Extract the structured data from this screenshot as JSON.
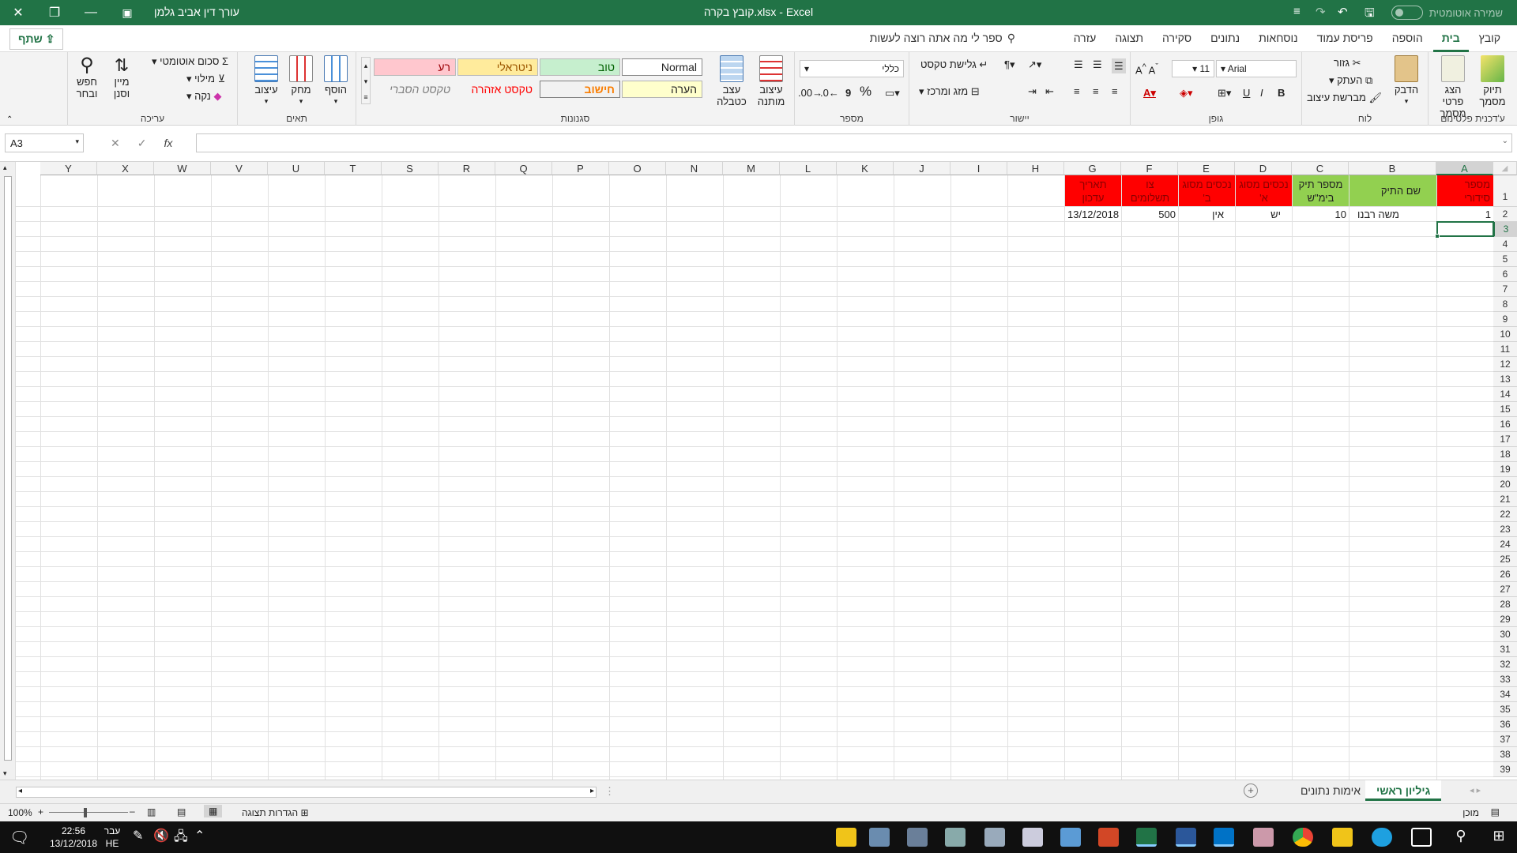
{
  "window": {
    "title": "קובץ בקרה.xlsx  -  Excel",
    "user": "עורך דין אביב גלמן",
    "autosave_label": "שמירה אוטומטית"
  },
  "tabs": [
    "קובץ",
    "בית",
    "הוספה",
    "פריסת עמוד",
    "נוסחאות",
    "נתונים",
    "סקירה",
    "תצוגה",
    "עזרה"
  ],
  "tellme": "ספר לי מה אתה רוצה לעשות",
  "share": "שתף",
  "ribbon": {
    "addins": {
      "label": "ע'דכנית פלטינום",
      "btn1": "תיוק מסמך",
      "btn2": "הצג פרטי מסמך"
    },
    "clipboard": {
      "label": "לוח",
      "paste": "הדבק",
      "cut": "גזור",
      "copy": "העתק",
      "painter": "מברשת עיצוב"
    },
    "font": {
      "label": "גופן",
      "name": "Arial",
      "size": "11",
      "bold": "B",
      "italic": "I",
      "underline": "U"
    },
    "alignment": {
      "label": "יישור",
      "wrap": "גלישת טקסט",
      "merge": "מזג ומרכז"
    },
    "number": {
      "label": "מספר",
      "format": "כללי",
      "percent": "%",
      "comma": "9"
    },
    "styles": {
      "label": "סגנונות",
      "cond": "עיצוב מותנה",
      "table": "עצב כטבלה",
      "normal": "Normal",
      "good": "טוב",
      "neutral": "ניטראלי",
      "bad": "רע",
      "note": "הערה",
      "check": "חישוב",
      "warning": "טקסט אזהרה",
      "explanatory": "טקסט הסברי"
    },
    "cells": {
      "label": "תאים",
      "insert": "הוסף",
      "delete": "מחק",
      "format": "עיצוב"
    },
    "editing": {
      "label": "עריכה",
      "autosum": "סכום אוטומטי",
      "fill": "מילוי",
      "clear": "נקה",
      "sort": "מיין וסנן",
      "find": "חפש ובחר"
    }
  },
  "namebox": "A3",
  "columns": [
    "A",
    "B",
    "C",
    "D",
    "E",
    "F",
    "G",
    "H",
    "I",
    "J",
    "K",
    "L",
    "M",
    "N",
    "O",
    "P",
    "Q",
    "R",
    "S",
    "T",
    "U",
    "V",
    "W",
    "X",
    "Y"
  ],
  "rows": [
    "1",
    "2",
    "3",
    "4",
    "5",
    "6",
    "7",
    "8",
    "9",
    "10",
    "11",
    "12",
    "13",
    "14",
    "15",
    "16",
    "17",
    "18",
    "19",
    "20",
    "21",
    "22",
    "23",
    "24",
    "25",
    "26",
    "27",
    "28",
    "29",
    "30",
    "31",
    "32",
    "33",
    "34",
    "35",
    "36",
    "37",
    "38",
    "39"
  ],
  "cells": {
    "A1": "מספר סידורי",
    "B1": "שם התיק",
    "C1": "מספר תיק בימ\"ש",
    "D1": "נכסים מסוג א'",
    "E1": "נכסים מסוג ב'",
    "F1": "צו תשלומים",
    "G1": "תאריך עדכון",
    "A2": "1",
    "B2": "משה רבנו",
    "C2": "10",
    "D2": "יש",
    "E2": "אין",
    "F2": "500",
    "G2": "13/12/2018"
  },
  "header_colors": {
    "red": "#ff0000",
    "green": "#92d050"
  },
  "sheet_tabs": [
    "גיליון ראשי",
    "אימות נתונים"
  ],
  "status": {
    "ready": "מוכן",
    "zoom": "100%",
    "display_settings": "הגדרות תצוגה"
  },
  "taskbar": {
    "time": "22:56",
    "date": "13/12/2018",
    "lang1": "עבר",
    "lang2": "HE"
  }
}
